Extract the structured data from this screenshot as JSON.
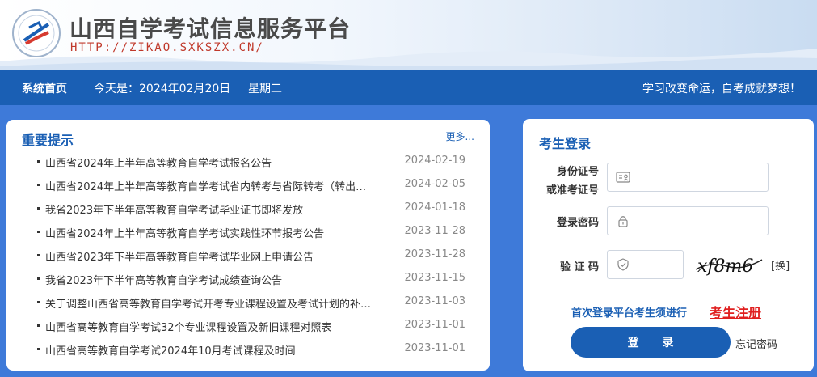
{
  "header": {
    "site_title": "山西自学考试信息服务平台",
    "site_url": "HTTP://ZIKAO.SXKSZX.CN/",
    "logo_icon": "exam-center-emblem-icon"
  },
  "navbar": {
    "home_label": "系统首页",
    "date_text": "今天是：2024年02月20日",
    "weekday_text": "星期二",
    "slogan": "学习改变命运，自考成就梦想！"
  },
  "notice": {
    "title": "重要提示",
    "more_label": "更多...",
    "items": [
      {
        "title": "山西省2024年上半年高等教育自学考试报名公告",
        "date": "2024-02-19"
      },
      {
        "title": "山西省2024年上半年高等教育自学考试省内转考与省际转考（转出…",
        "date": "2024-02-05"
      },
      {
        "title": "我省2023年下半年高等教育自学考试毕业证书即将发放",
        "date": "2024-01-18"
      },
      {
        "title": "山西省2024年上半年高等教育自学考试实践性环节报考公告",
        "date": "2023-11-28"
      },
      {
        "title": "山西省2023年下半年高等教育自学考试毕业网上申请公告",
        "date": "2023-11-28"
      },
      {
        "title": "我省2023年下半年高等教育自学考试成绩查询公告",
        "date": "2023-11-15"
      },
      {
        "title": "关于调整山西省高等教育自学考试开考专业课程设置及考试计划的补…",
        "date": "2023-11-03"
      },
      {
        "title": "山西省高等教育自学考试32个专业课程设置及新旧课程对照表",
        "date": "2023-11-01"
      },
      {
        "title": "山西省高等教育自学考试2024年10月考试课程及时间",
        "date": "2023-11-01"
      }
    ]
  },
  "login": {
    "title": "考生登录",
    "id_label_line1": "身份证号",
    "id_label_line2": "或准考证号",
    "id_value": "",
    "password_label": "登录密码",
    "password_value": "",
    "captcha_label": "验 证 码",
    "captcha_value": "",
    "captcha_text": "xf8m6",
    "captcha_refresh": "[换]",
    "register_prompt": "首次登录平台考生须进行",
    "register_link": "考生注册",
    "login_button": "登  录",
    "forgot_link": "忘记密码"
  },
  "colors": {
    "primary": "#1a5fb4",
    "background": "#3e7ad9",
    "register_red": "#e02020",
    "url_red": "#c0392b"
  }
}
